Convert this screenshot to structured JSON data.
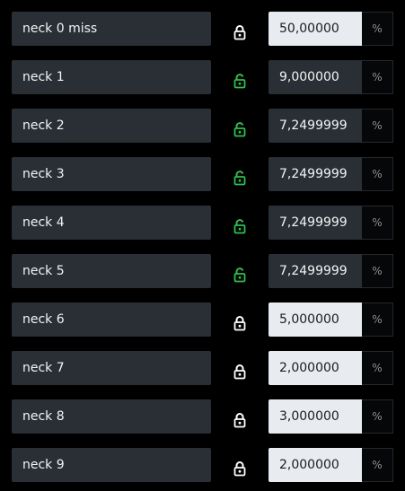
{
  "colors": {
    "background": "#000000",
    "field_dark": "#2a2f35",
    "field_light": "#e8ebef",
    "lock_locked": "#ffffff",
    "lock_unlocked": "#2fbf4f"
  },
  "rows": [
    {
      "label": "neck 0 miss",
      "value": "50,00000",
      "unit": "%",
      "lock_icon": "lock-closed-icon",
      "locked": true
    },
    {
      "label": "neck 1",
      "value": "9,000000",
      "unit": "%",
      "lock_icon": "lock-open-icon",
      "locked": false
    },
    {
      "label": "neck 2",
      "value": "7,2499999",
      "unit": "%",
      "lock_icon": "lock-open-icon",
      "locked": false
    },
    {
      "label": "neck 3",
      "value": "7,2499999",
      "unit": "%",
      "lock_icon": "lock-open-icon",
      "locked": false
    },
    {
      "label": "neck 4",
      "value": "7,2499999",
      "unit": "%",
      "lock_icon": "lock-open-icon",
      "locked": false
    },
    {
      "label": "neck 5",
      "value": "7,2499999",
      "unit": "%",
      "lock_icon": "lock-open-icon",
      "locked": false
    },
    {
      "label": "neck 6",
      "value": "5,000000",
      "unit": "%",
      "lock_icon": "lock-closed-icon",
      "locked": true
    },
    {
      "label": "neck 7",
      "value": "2,000000",
      "unit": "%",
      "lock_icon": "lock-closed-icon",
      "locked": true
    },
    {
      "label": "neck 8",
      "value": "3,000000",
      "unit": "%",
      "lock_icon": "lock-closed-icon",
      "locked": true
    },
    {
      "label": "neck 9",
      "value": "2,000000",
      "unit": "%",
      "lock_icon": "lock-closed-icon",
      "locked": true
    }
  ]
}
